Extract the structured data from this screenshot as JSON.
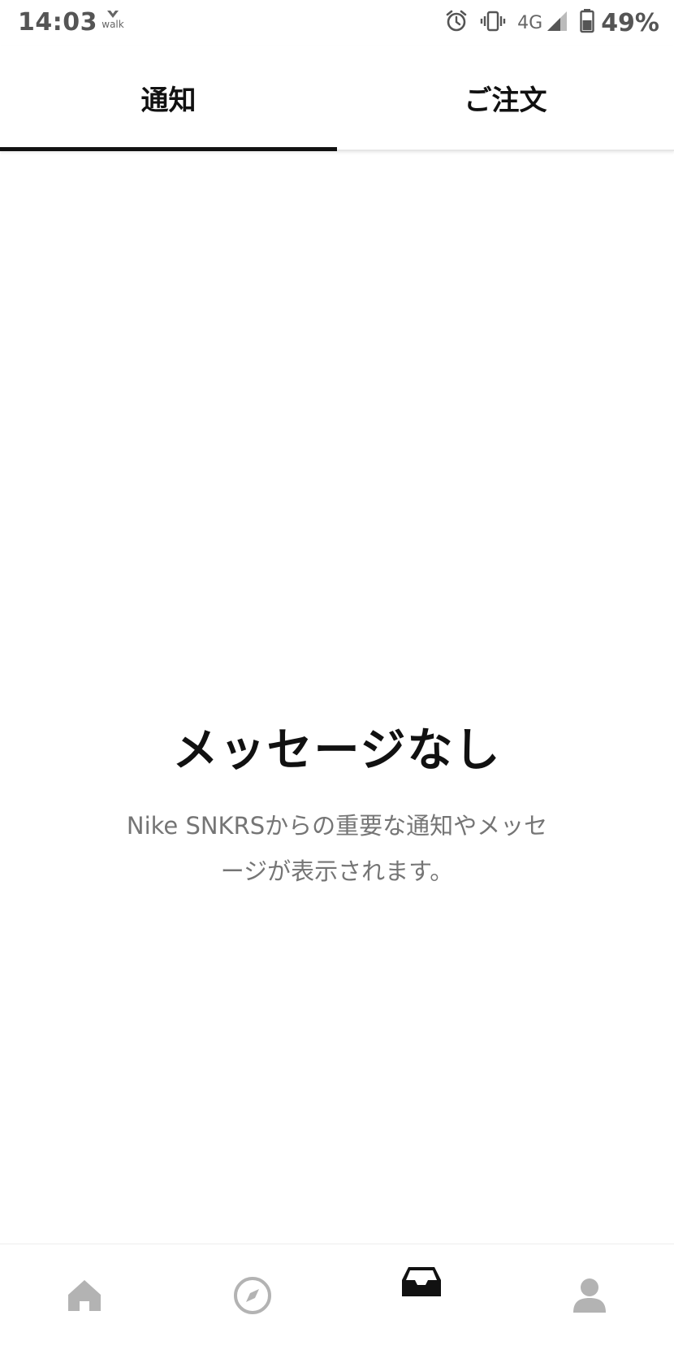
{
  "status_bar": {
    "time": "14:03",
    "walk_app_label": "walk",
    "network": "4G",
    "battery": "49%",
    "icons": [
      "walk-app-icon",
      "alarm-icon",
      "vibrate-icon",
      "signal-icon",
      "battery-icon"
    ]
  },
  "tabs": [
    {
      "label": "通知",
      "selected": true
    },
    {
      "label": "ご注文",
      "selected": false
    }
  ],
  "empty_state": {
    "title": "メッセージなし",
    "message_line1": "Nike SNKRSからの重要な通知やメッセ",
    "message_line2": "ージが表示されます。"
  },
  "bottom_nav": [
    {
      "icon": "home-icon",
      "active": false
    },
    {
      "icon": "compass-icon",
      "active": false
    },
    {
      "icon": "inbox-icon",
      "active": true
    },
    {
      "icon": "profile-icon",
      "active": false
    }
  ],
  "colors": {
    "text_primary": "#111111",
    "text_secondary": "#757575",
    "icon_inactive": "#b3b3b3",
    "icon_active": "#111111",
    "divider": "#e6e6e6"
  }
}
